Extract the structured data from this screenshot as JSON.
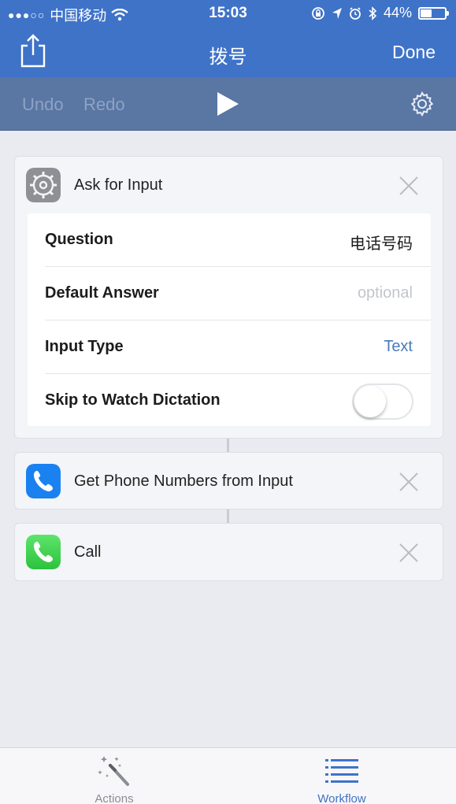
{
  "status_bar": {
    "carrier": "中国移动",
    "time": "15:03",
    "battery_percent": "44%",
    "battery_level": 0.44
  },
  "nav": {
    "title": "拨号",
    "done_label": "Done"
  },
  "toolbar": {
    "undo_label": "Undo",
    "redo_label": "Redo"
  },
  "actions": [
    {
      "title": "Ask for Input",
      "icon": "gear-icon",
      "params": [
        {
          "label": "Question",
          "value": "电话号码"
        },
        {
          "label": "Default Answer",
          "placeholder": "optional"
        },
        {
          "label": "Input Type",
          "value": "Text"
        },
        {
          "label": "Skip to Watch Dictation",
          "toggle_on": false
        }
      ]
    },
    {
      "title": "Get Phone Numbers from Input",
      "icon": "phone-icon"
    },
    {
      "title": "Call",
      "icon": "phone-icon"
    }
  ],
  "tabs": [
    {
      "label": "Actions",
      "icon": "magic-wand-icon",
      "selected": false
    },
    {
      "label": "Workflow",
      "icon": "list-icon",
      "selected": true
    }
  ],
  "colors": {
    "accent": "#3f73c8",
    "toolbar": "#5a76a3",
    "background": "#e9ebf0",
    "phone_blue": "#1a82f0",
    "phone_green": "#3fd24f",
    "link": "#4a7ab8"
  }
}
